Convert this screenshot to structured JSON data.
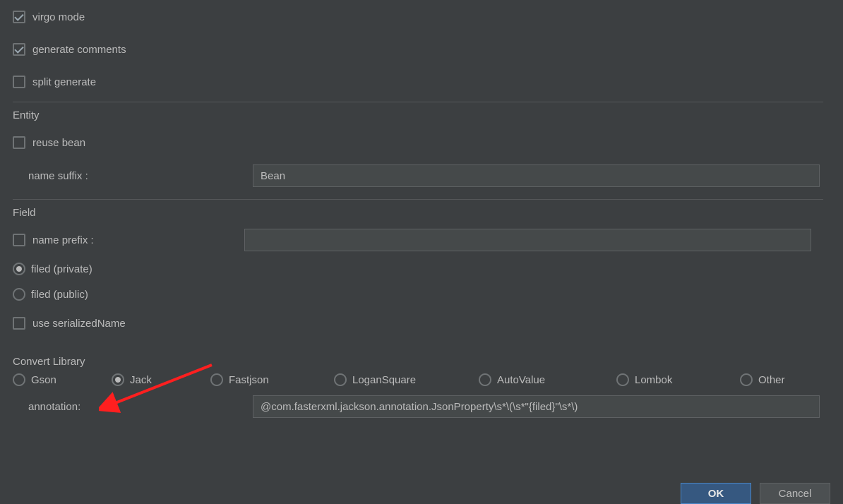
{
  "general": {
    "virgo_mode": {
      "label": "virgo mode",
      "checked": true
    },
    "generate_comments": {
      "label": "generate comments",
      "checked": true
    },
    "split_generate": {
      "label": "split generate",
      "checked": false
    }
  },
  "entity": {
    "title": "Entity",
    "reuse_bean": {
      "label": "reuse bean",
      "checked": false
    },
    "name_suffix_label": "name suffix :",
    "name_suffix_value": "Bean"
  },
  "field": {
    "title": "Field",
    "name_prefix": {
      "label": "name prefix :",
      "checked": false
    },
    "name_prefix_value": "",
    "visibility": {
      "private_label": "filed (private)",
      "public_label": "filed (public)",
      "selected": "private"
    },
    "use_serialized_name": {
      "label": "use serializedName",
      "checked": false
    }
  },
  "convert_library": {
    "title": "Convert Library",
    "options": {
      "gson": "Gson",
      "jack": "Jack",
      "fastjson": "Fastjson",
      "logansquare": "LoganSquare",
      "autovalue": "AutoValue",
      "lombok": "Lombok",
      "other": "Other"
    },
    "selected": "jack",
    "annotation_label": "annotation:",
    "annotation_value": "@com.fasterxml.jackson.annotation.JsonProperty\\s*\\(\\s*\"{filed}\"\\s*\\)"
  },
  "buttons": {
    "ok": "OK",
    "cancel": "Cancel"
  }
}
